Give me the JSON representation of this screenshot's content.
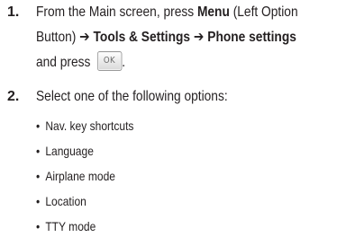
{
  "step1": {
    "number": "1.",
    "line1_pre": "From the Main screen, press ",
    "line1_menu": "Menu",
    "line1_post": " (Left Option",
    "line2_pre": "Button) ",
    "arrow": "➔",
    "tools": "Tools & Settings",
    "phone": "Phone settings",
    "line3_pre": "and press ",
    "ok_key_label": "OK",
    "line3_post": "."
  },
  "step2": {
    "number": "2.",
    "text": "Select one of the following options:"
  },
  "options": [
    "Nav. key shortcuts",
    "Language",
    "Airplane mode",
    "Location",
    "TTY mode"
  ]
}
